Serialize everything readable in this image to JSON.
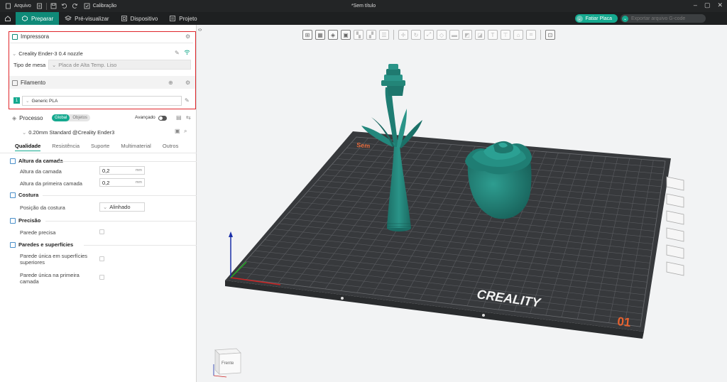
{
  "titlebar": {
    "menu_file": "Arquivo",
    "calibration": "Calibração",
    "doc_title": "*Sem título"
  },
  "tabs": {
    "prepare": "Preparar",
    "preview": "Pré-visualizar",
    "device": "Dispositivo",
    "project": "Projeto"
  },
  "actions": {
    "slice": "Fatiar Placa",
    "export": "Exportar arquivo G-code"
  },
  "printer": {
    "section": "Impressora",
    "selected": "Creality Ender-3 0.4 nozzle",
    "bed_label": "Tipo de mesa",
    "bed_value": "Placa de Alta Temp. Liso"
  },
  "filament": {
    "section": "Filamento",
    "index": "1",
    "selected": "Generic PLA"
  },
  "process": {
    "section": "Processo",
    "global": "Global",
    "objects": "Objetos",
    "advanced": "Avançado",
    "preset": "0.20mm Standard @Creality Ender3"
  },
  "subtabs": [
    "Qualidade",
    "Resistência",
    "Suporte",
    "Multimaterial",
    "Outros"
  ],
  "groups": {
    "layer_height": "Altura da camada",
    "seam": "Costura",
    "precision": "Precisão",
    "walls": "Paredes e superfícies"
  },
  "params": {
    "layer_height_label": "Altura da camada",
    "layer_height_value": "0,2",
    "first_layer_label": "Altura da primeira camada",
    "first_layer_value": "0,2",
    "unit": "mm",
    "seam_pos_label": "Posição da costura",
    "seam_pos_value": "Alinhado",
    "precise_wall_label": "Parede precisa",
    "single_top_label": "Parede única em superfícies superiores",
    "single_first_label": "Parede única na primeira camada"
  },
  "viewport": {
    "bed_brand": "CREALITY",
    "plate_number": "01",
    "plate_label": "Sem",
    "cube_front": "Frente"
  },
  "colors": {
    "accent": "#15a98f",
    "model": "#1f7a70",
    "bed": "#3a3c3f",
    "highlight": "#e0262b"
  }
}
